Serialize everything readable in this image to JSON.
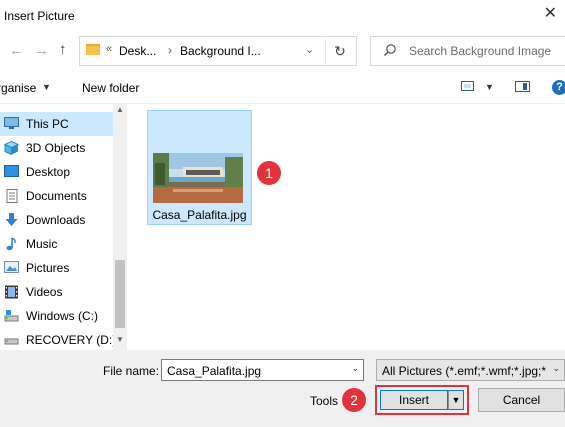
{
  "window": {
    "title": "Insert Picture",
    "close_glyph": "✕"
  },
  "nav": {
    "back_glyph": "←",
    "forward_glyph": "→",
    "up_glyph": "↑",
    "breadcrumb_chevron": "«",
    "breadcrumb": [
      "Desk...",
      "Background I..."
    ],
    "breadcrumb_sep": "›",
    "refresh_glyph": "↻",
    "search_placeholder": "Search Background Image"
  },
  "toolbar": {
    "organise_label": "rganise",
    "new_folder_label": "New folder",
    "help_glyph": "?"
  },
  "sidebar": {
    "items": [
      {
        "label": "This PC",
        "icon": "computer-icon",
        "selected": true
      },
      {
        "label": "3D Objects",
        "icon": "cube-icon"
      },
      {
        "label": "Desktop",
        "icon": "desktop-icon"
      },
      {
        "label": "Documents",
        "icon": "documents-icon"
      },
      {
        "label": "Downloads",
        "icon": "download-arrow-icon"
      },
      {
        "label": "Music",
        "icon": "music-note-icon"
      },
      {
        "label": "Pictures",
        "icon": "pictures-icon"
      },
      {
        "label": "Videos",
        "icon": "film-icon"
      },
      {
        "label": "Windows (C:)",
        "icon": "drive-icon"
      },
      {
        "label": "RECOVERY (D:)",
        "icon": "drive-icon"
      }
    ]
  },
  "content": {
    "files": [
      {
        "name": "Casa_Palafita.jpg",
        "selected": true
      }
    ]
  },
  "annotations": {
    "badge1": "1",
    "badge2": "2"
  },
  "footer": {
    "file_name_label": "File name:",
    "file_name_value": "Casa_Palafita.jpg",
    "file_type_value": "All Pictures (*.emf;*.wmf;*.jpg;*",
    "tools_label": "Tools",
    "insert_label": "Insert",
    "cancel_label": "Cancel"
  },
  "colors": {
    "selection": "#cce8ff",
    "badge": "#e0333b",
    "accent": "#0078d7"
  }
}
